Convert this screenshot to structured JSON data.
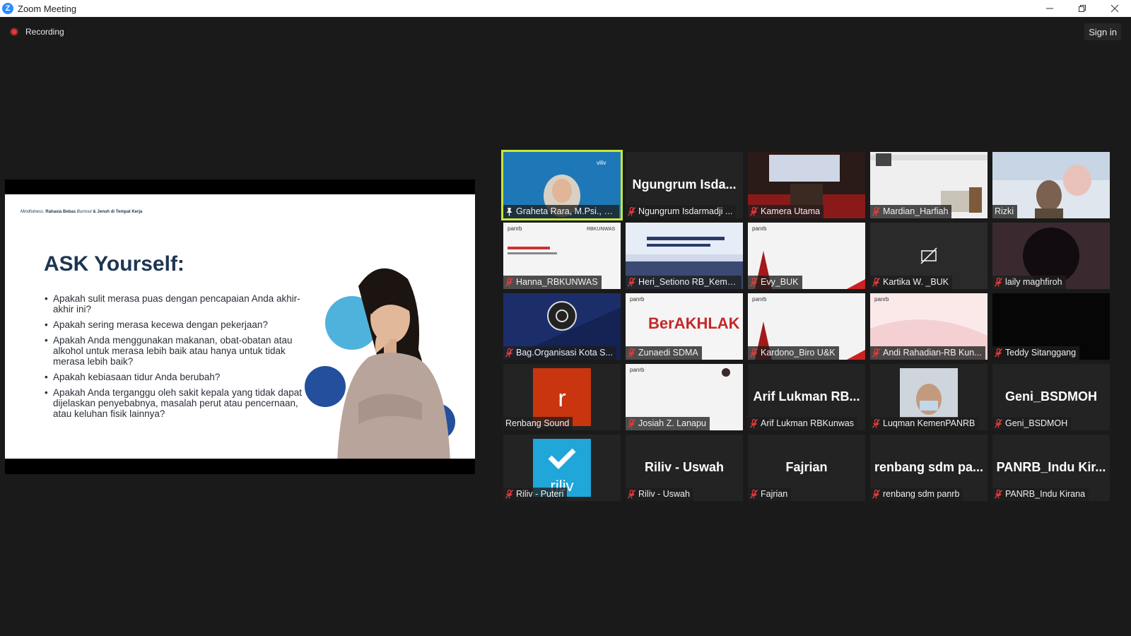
{
  "window": {
    "title": "Zoom Meeting",
    "app_icon": "zoom-logo",
    "controls": [
      "minimize-icon",
      "restore-icon",
      "close-icon"
    ]
  },
  "top": {
    "recording_label": "Recording",
    "signin_label": "Sign in"
  },
  "slide": {
    "header_italic": "Mindfulness:",
    "header_bold": "Rahasia Bebas",
    "header_bold_italic": "Burnout",
    "header_bold_end": "& Jenuh di Tempat Kerja",
    "title": "ASK Yourself:",
    "bullets": [
      "Apakah sulit merasa puas dengan pencapaian Anda akhir-akhir ini?",
      "Apakah sering merasa kecewa dengan pekerjaan?",
      "Apakah Anda menggunakan makanan, obat-obatan atau alkohol untuk merasa lebih baik atau hanya untuk tidak merasa lebih baik?",
      "Apakah kebiasaan tidur Anda berubah?",
      "Apakah Anda terganggu oleh sakit kepala yang tidak dapat dijelaskan penyebabnya, masalah perut atau pencernaan, atau keluhan fisik lainnya?"
    ]
  },
  "participants": [
    {
      "label": "Graheta Rara, M.Psi., P...",
      "big": "",
      "muted": false,
      "pinned": true,
      "active": true
    },
    {
      "label": "Ngungrum Isdarmadji ...",
      "big": "Ngungrum Isda...",
      "muted": true
    },
    {
      "label": "Kamera Utama",
      "big": "",
      "muted": true
    },
    {
      "label": "Mardian_Harfiah",
      "big": "",
      "muted": true
    },
    {
      "label": "Rizki",
      "big": "",
      "muted": false
    },
    {
      "label": "Hanna_RBKUNWAS",
      "big": "",
      "muted": true
    },
    {
      "label": "Heri_Setiono RB_Keme...",
      "big": "",
      "muted": true
    },
    {
      "label": "Evy_BUK",
      "big": "",
      "muted": true
    },
    {
      "label": "Kartika W. _BUK",
      "big": "",
      "muted": true
    },
    {
      "label": "laily maghfiroh",
      "big": "",
      "muted": true
    },
    {
      "label": "Bag.Organisasi Kota S...",
      "big": "",
      "muted": true
    },
    {
      "label": "Zunaedi SDMA",
      "big": "",
      "muted": true
    },
    {
      "label": "Kardono_Biro U&K",
      "big": "",
      "muted": true
    },
    {
      "label": "Andi Rahadian-RB Kun...",
      "big": "",
      "muted": true
    },
    {
      "label": "Teddy Sitanggang",
      "big": "",
      "muted": true
    },
    {
      "label": "Renbang Sound",
      "big": "",
      "muted": false
    },
    {
      "label": "Josiah Z. Lanapu",
      "big": "",
      "muted": true
    },
    {
      "label": "Arif Lukman RBKunwas",
      "big": "Arif Lukman RB...",
      "muted": true
    },
    {
      "label": "Luqman KemenPANRB",
      "big": "",
      "muted": true
    },
    {
      "label": "Geni_BSDMOH",
      "big": "Geni_BSDMOH",
      "muted": true
    },
    {
      "label": "Riliv - Puteri",
      "big": "",
      "muted": true
    },
    {
      "label": "Riliv - Uswah",
      "big": "Riliv - Uswah",
      "muted": true
    },
    {
      "label": "Fajrian",
      "big": "Fajrian",
      "muted": true
    },
    {
      "label": "renbang sdm panrb",
      "big": "renbang sdm pa...",
      "muted": true
    },
    {
      "label": "PANRB_Indu Kirana",
      "big": "PANRB_Indu  Kir...",
      "muted": true
    }
  ],
  "tile_content": {
    "vlogo": "viliv",
    "avatar_letter": "r",
    "riliv_logo": "riliv",
    "berakhlak": "BerAKHLAK",
    "panrb": "panrb",
    "rbkunwas": "RBKUNWAS"
  },
  "colors": {
    "active_border": "#c6e83a",
    "mic_muted": "#e03c3c",
    "background": "#1a1a1a"
  }
}
